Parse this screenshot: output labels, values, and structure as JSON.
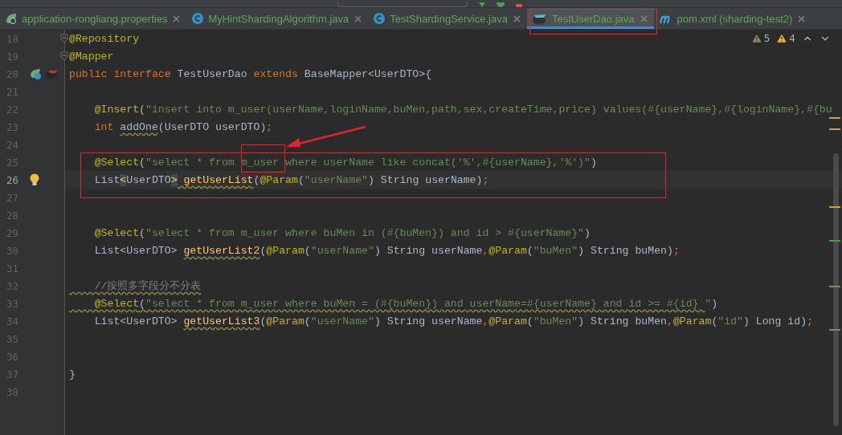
{
  "tabs": [
    {
      "label": "application-rongliang.properties",
      "kind": "spring",
      "selected": false
    },
    {
      "label": "MyHintShardingAlgorithm.java",
      "kind": "class",
      "selected": false
    },
    {
      "label": "TestShardingService.java",
      "kind": "class",
      "selected": false
    },
    {
      "label": "TestUserDao.java",
      "kind": "mapper",
      "selected": true
    },
    {
      "label": "pom.xml (sharding-test2)",
      "kind": "maven",
      "selected": false
    }
  ],
  "inspections": [
    {
      "kind": "weak",
      "count": "5"
    },
    {
      "kind": "warning",
      "count": "4"
    }
  ],
  "lines": [
    {
      "number": "18",
      "fold_marker": true,
      "tokens": [
        {
          "kind": "ann",
          "text": "@Repository"
        }
      ]
    },
    {
      "number": "19",
      "fold_marker": true,
      "tokens": [
        {
          "kind": "ann",
          "text": "@Mapper"
        }
      ]
    },
    {
      "number": "20",
      "markers": [
        {
          "kind": "implementation"
        },
        {
          "kind": "mapper"
        }
      ],
      "tokens": [
        {
          "kind": "kw",
          "text": "public interface "
        },
        {
          "kind": "txt",
          "text": "TestUserDao "
        },
        {
          "kind": "kw",
          "text": "extends "
        },
        {
          "kind": "txt",
          "text": "BaseMapper<UserDTO>{"
        }
      ]
    },
    {
      "number": "21"
    },
    {
      "number": "22",
      "tokens": [
        {
          "kind": "ann",
          "text": "    @Insert"
        },
        {
          "kind": "txt",
          "text": "("
        },
        {
          "kind": "str",
          "text": "\"insert into m_user(userName,loginName,buMen,path,sex,createTime,price) values(#{userName},#{loginName},#{bu"
        }
      ]
    },
    {
      "number": "23",
      "tokens": [
        {
          "kind": "kw",
          "text": "    int "
        },
        {
          "kind": "txt",
          "text": "addOne",
          "warning": true
        },
        {
          "kind": "txt",
          "text": "(UserDTO userDTO)"
        },
        {
          "kind": "punct",
          "text": ";"
        }
      ]
    },
    {
      "number": "24"
    },
    {
      "number": "25",
      "tokens": [
        {
          "kind": "ann",
          "text": "    @Select"
        },
        {
          "kind": "txt",
          "text": "("
        },
        {
          "kind": "str",
          "text": "\"select * from m_user where userName like concat('%',#{userName},'%')\""
        },
        {
          "kind": "txt",
          "text": ")"
        }
      ]
    },
    {
      "number": "26",
      "current": true,
      "markers": [
        {
          "kind": "intention"
        }
      ],
      "tokens": [
        {
          "kind": "txt",
          "text": "    List"
        },
        {
          "kind": "bracket",
          "text": "<"
        },
        {
          "kind": "txt",
          "text": "UserDTO"
        },
        {
          "kind": "bracket",
          "text": ">"
        },
        {
          "kind": "fn",
          "text": " getUserList",
          "warning": true
        },
        {
          "kind": "txt",
          "text": "("
        },
        {
          "kind": "ann",
          "text": "@Param"
        },
        {
          "kind": "txt",
          "text": "("
        },
        {
          "kind": "str",
          "text": "\"userName\""
        },
        {
          "kind": "txt",
          "text": ") String userName)"
        },
        {
          "kind": "punct",
          "text": ";"
        }
      ]
    },
    {
      "number": "27"
    },
    {
      "number": "28"
    },
    {
      "number": "29",
      "tokens": [
        {
          "kind": "ann",
          "text": "    @Select"
        },
        {
          "kind": "txt",
          "text": "("
        },
        {
          "kind": "str",
          "text": "\"select * from m_user where buMen in (#{buMen}) and id > #{userName}\""
        },
        {
          "kind": "txt",
          "text": ")"
        }
      ]
    },
    {
      "number": "30",
      "tokens": [
        {
          "kind": "txt",
          "text": "    List<UserDTO> "
        },
        {
          "kind": "fn",
          "text": "getUserList2",
          "warning": true
        },
        {
          "kind": "txt",
          "text": "("
        },
        {
          "kind": "ann",
          "text": "@Param"
        },
        {
          "kind": "txt",
          "text": "("
        },
        {
          "kind": "str",
          "text": "\"userName\""
        },
        {
          "kind": "txt",
          "text": ") String userName"
        },
        {
          "kind": "punct",
          "text": ","
        },
        {
          "kind": "ann",
          "text": "@Param"
        },
        {
          "kind": "txt",
          "text": "("
        },
        {
          "kind": "str",
          "text": "\"buMen\""
        },
        {
          "kind": "txt",
          "text": ") String buMen)"
        },
        {
          "kind": "punct",
          "text": ";"
        }
      ]
    },
    {
      "number": "31"
    },
    {
      "number": "32",
      "tokens": [
        {
          "kind": "cmt",
          "text": "    //按照多字段分不分表",
          "warning": true
        }
      ]
    },
    {
      "number": "33",
      "tokens": [
        {
          "kind": "ann",
          "text": "    @Select",
          "warning": true
        },
        {
          "kind": "txt",
          "text": "(",
          "warning": true
        },
        {
          "kind": "str",
          "text": "\"select * from m_user where buMen = (#{buMen}) and userName=#{userName} and id >= #{id} ",
          "warning": true
        },
        {
          "kind": "str",
          "text": "\""
        },
        {
          "kind": "txt",
          "text": ")"
        }
      ]
    },
    {
      "number": "34",
      "tokens": [
        {
          "kind": "txt",
          "text": "    List<UserDTO> "
        },
        {
          "kind": "fn",
          "text": "getUserList3",
          "warning": true
        },
        {
          "kind": "txt",
          "text": "("
        },
        {
          "kind": "ann",
          "text": "@Param"
        },
        {
          "kind": "txt",
          "text": "("
        },
        {
          "kind": "str",
          "text": "\"userName\""
        },
        {
          "kind": "txt",
          "text": ") String userName"
        },
        {
          "kind": "punct",
          "text": ","
        },
        {
          "kind": "ann",
          "text": "@Param"
        },
        {
          "kind": "txt",
          "text": "("
        },
        {
          "kind": "str",
          "text": "\"buMen\""
        },
        {
          "kind": "txt",
          "text": ") String buMen"
        },
        {
          "kind": "punct",
          "text": ","
        },
        {
          "kind": "ann",
          "text": "@Param"
        },
        {
          "kind": "txt",
          "text": "("
        },
        {
          "kind": "str",
          "text": "\"id\""
        },
        {
          "kind": "txt",
          "text": ") Long id)"
        },
        {
          "kind": "punct",
          "text": ";"
        }
      ]
    },
    {
      "number": "35"
    },
    {
      "number": "36"
    },
    {
      "number": "37",
      "tokens": [
        {
          "kind": "txt",
          "text": "}"
        }
      ]
    },
    {
      "number": "38"
    }
  ]
}
